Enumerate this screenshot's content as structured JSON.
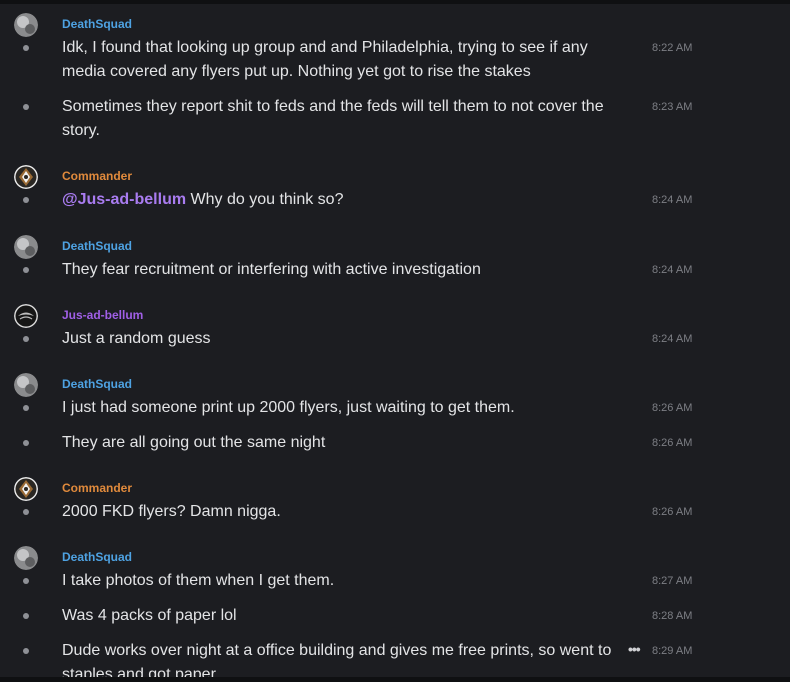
{
  "colors": {
    "deathsquad": "#4ea2e2",
    "commander": "#e08a3c",
    "jus": "#a05fe6",
    "mention": "#a97cf0",
    "background": "#1c1d21"
  },
  "icons": {
    "more_actions": "more-horizontal-icon"
  },
  "messages": [
    {
      "author": "DeathSquad",
      "text": "Idk, I found that looking up group and and Philadelphia, trying to see if any media covered any flyers put up. Nothing yet got to rise the stakes",
      "time": "8:22 AM"
    },
    {
      "text": "Sometimes they report shit to feds and the feds will tell them to not cover the story.",
      "time": "8:23 AM"
    },
    {
      "author": "Commander",
      "mention": "@Jus-ad-bellum",
      "text": " Why do you think so?",
      "time": "8:24 AM"
    },
    {
      "author": "DeathSquad",
      "text": "They fear recruitment or interfering with active investigation",
      "time": "8:24 AM"
    },
    {
      "author": "Jus-ad-bellum",
      "text": "Just a random guess",
      "time": "8:24 AM"
    },
    {
      "author": "DeathSquad",
      "text": "I just had someone print up 2000 flyers, just waiting to get them.",
      "time": "8:26 AM"
    },
    {
      "text": "They are all going out the same night",
      "time": "8:26 AM"
    },
    {
      "author": "Commander",
      "text": "2000 FKD flyers? Damn nigga.",
      "time": "8:26 AM"
    },
    {
      "author": "DeathSquad",
      "text": "I take photos of them when I get them.",
      "time": "8:27 AM"
    },
    {
      "text": "Was 4 packs of paper lol",
      "time": "8:28 AM"
    },
    {
      "text": "Dude works over night at a office building and gives me free prints, so went to staples and got paper",
      "time": "8:29 AM"
    }
  ]
}
